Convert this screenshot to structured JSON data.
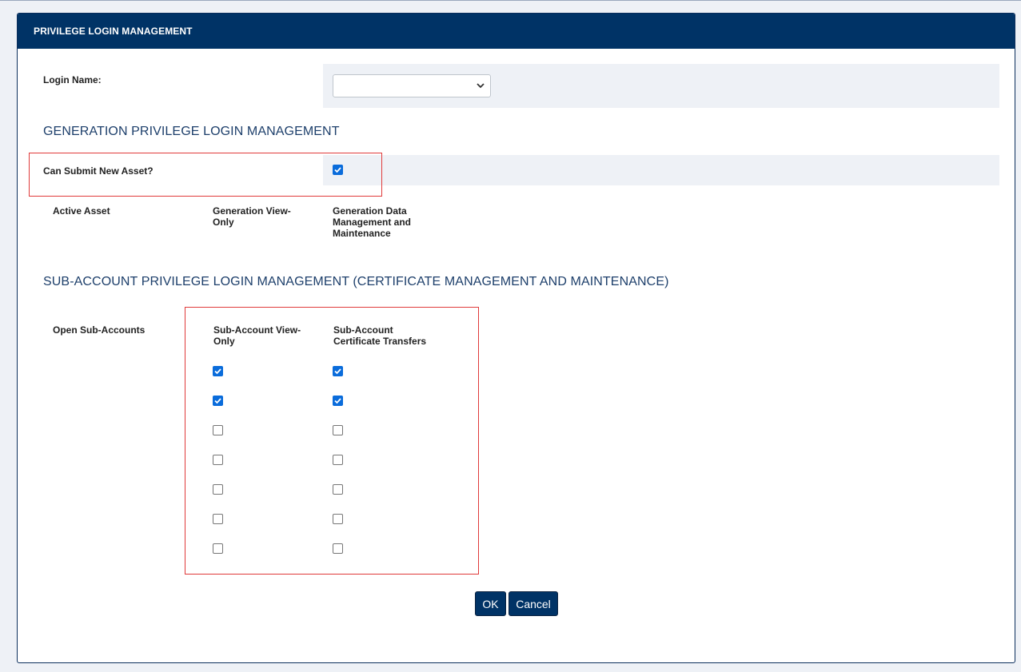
{
  "dialog": {
    "title": "PRIVILEGE LOGIN MANAGEMENT"
  },
  "login": {
    "label": "Login Name:",
    "selected_value": ""
  },
  "generation": {
    "section_title": "GENERATION PRIVILEGE LOGIN MANAGEMENT",
    "submit_label": "Can Submit New Asset?",
    "submit_checked": true,
    "columns": [
      "Active Asset",
      "Generation View-Only",
      "Generation Data Management and Maintenance"
    ]
  },
  "subaccount": {
    "section_title": "SUB-ACCOUNT PRIVILEGE LOGIN MANAGEMENT (CERTIFICATE MANAGEMENT AND MAINTENANCE)",
    "columns": [
      "Open Sub-Accounts",
      "Sub-Account View-Only",
      "Sub-Account Certificate Transfers"
    ],
    "rows": [
      {
        "view_only": true,
        "transfers": true
      },
      {
        "view_only": true,
        "transfers": true
      },
      {
        "view_only": false,
        "transfers": false
      },
      {
        "view_only": false,
        "transfers": false
      },
      {
        "view_only": false,
        "transfers": false
      },
      {
        "view_only": false,
        "transfers": false
      },
      {
        "view_only": false,
        "transfers": false
      }
    ]
  },
  "buttons": {
    "ok": "OK",
    "cancel": "Cancel"
  },
  "colors": {
    "header": "#003366",
    "accent": "#0a6cdb",
    "highlight": "#e03a3a",
    "field_bg": "#eef1f6"
  },
  "icons": {
    "select_arrow": "chevron-down-icon",
    "check": "checkmark-icon"
  }
}
